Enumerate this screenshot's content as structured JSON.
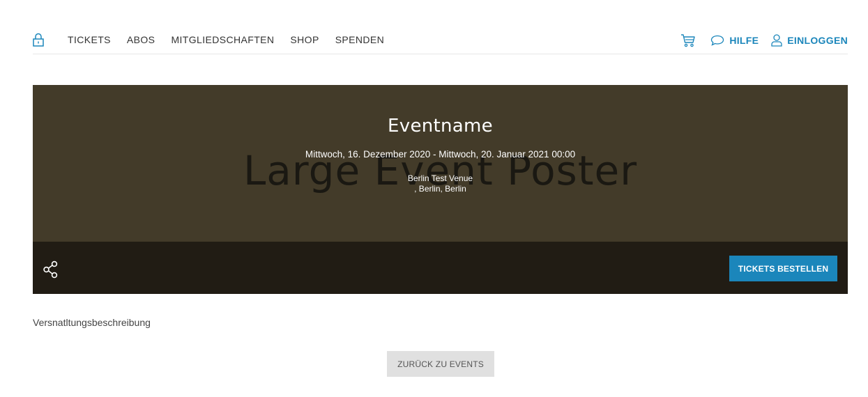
{
  "nav": {
    "lock_icon": "lock-icon",
    "links": [
      "TICKETS",
      "ABOS",
      "MITGLIEDSCHAFTEN",
      "SHOP",
      "SPENDEN"
    ],
    "cart_icon": "cart-icon",
    "help_label": "HILFE",
    "login_label": "EINLOGGEN",
    "accent_color": "#1b86bb"
  },
  "hero": {
    "poster_text": "Large Event Poster",
    "title": "Eventname",
    "date": "Mittwoch, 16. Dezember 2020 - Mittwoch, 20. Januar 2021 00:00",
    "venue_name": "Berlin Test Venue",
    "venue_location": ", Berlin, Berlin",
    "background_color": "#433b29"
  },
  "action_bar": {
    "share_icon": "share-icon",
    "order_button_label": "TICKETS BESTELLEN",
    "background_color": "#211c14"
  },
  "content": {
    "description": "Versnatltungsbeschreibung",
    "back_button_label": "ZURÜCK ZU EVENTS"
  }
}
